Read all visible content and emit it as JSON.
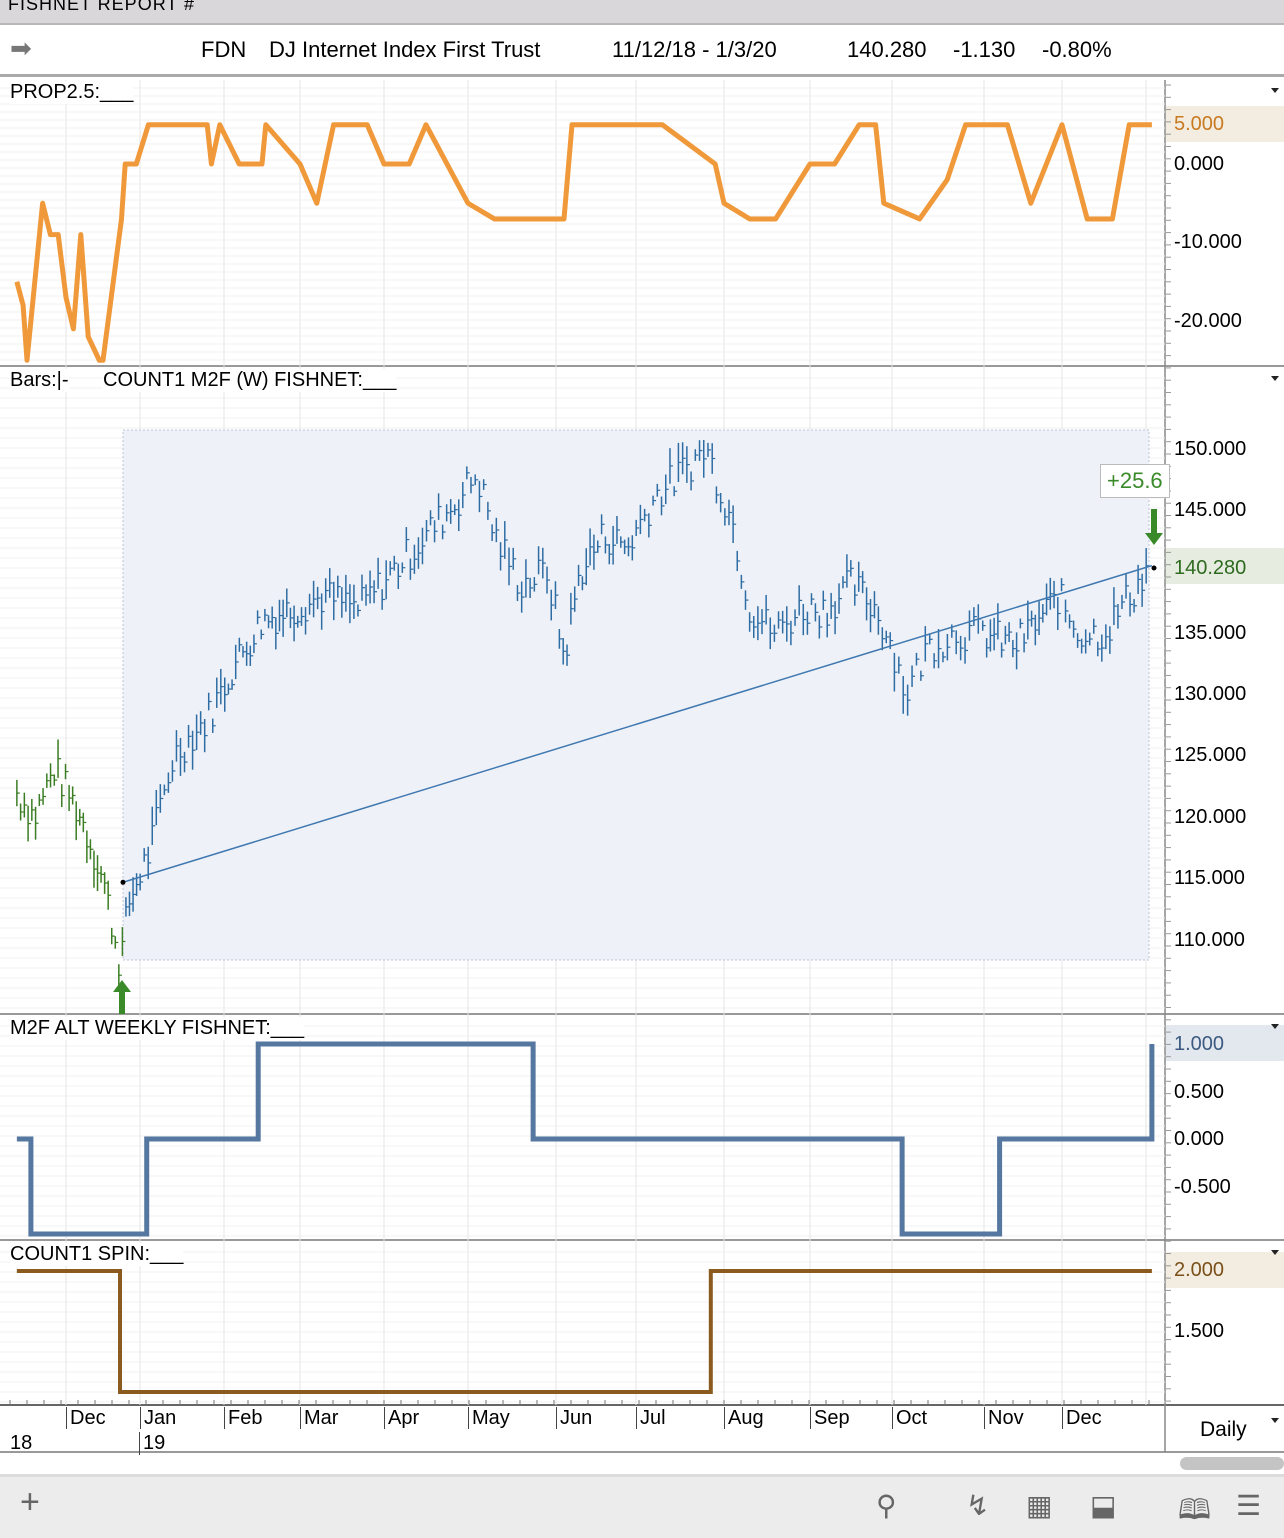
{
  "window": {
    "title": "FISHNET  REPORT #"
  },
  "header": {
    "symbol": "FDN",
    "name": "DJ Internet Index First Trust",
    "date_range": "11/12/18 - 1/3/20",
    "last": "140.280",
    "change": "-1.130",
    "change_pct": "-0.80%"
  },
  "panels": {
    "prop": {
      "label": "PROP2.5:___",
      "axis": [
        "5.000",
        "0.000",
        "-10.000",
        "-20.000"
      ]
    },
    "price": {
      "label_bars": "Bars:|-",
      "label": "COUNT1 M2F (W) FISHNET:___",
      "axis": [
        "150.000",
        "145.000",
        "140.280",
        "135.000",
        "130.000",
        "125.000",
        "120.000",
        "115.000",
        "110.000"
      ],
      "gain_label": "+25.6"
    },
    "m2f": {
      "label": "M2F ALT WEEKLY FISHNET:___",
      "axis": [
        "1.000",
        "0.500",
        "0.000",
        "-0.500"
      ]
    },
    "spin": {
      "label": "COUNT1 SPIN:___",
      "axis": [
        "2.000",
        "1.500"
      ]
    }
  },
  "xaxis": {
    "months": [
      "Dec",
      "Jan",
      "Feb",
      "Mar",
      "Apr",
      "May",
      "Jun",
      "Jul",
      "Aug",
      "Sep",
      "Oct",
      "Nov",
      "Dec"
    ],
    "years": [
      "18",
      "19"
    ],
    "period": "Daily"
  },
  "colors": {
    "prop": "#f0993a",
    "price_up": "#2e6da4",
    "price_pre": "#3a7d23",
    "m2f": "#5577a0",
    "spin": "#8a5a1e",
    "gain": "#3a8a2a"
  },
  "chart_data": [
    {
      "type": "line",
      "title": "PROP2.5",
      "x_unit": "months since Nov 1 2018",
      "ylim": [
        -25,
        7
      ],
      "x": [
        0.37,
        0.45,
        0.5,
        0.6,
        0.7,
        0.8,
        0.9,
        1.0,
        1.1,
        1.2,
        1.3,
        1.45,
        1.5,
        1.75,
        1.8,
        1.95,
        2.1,
        2.15,
        2.8,
        2.85,
        2.95,
        3.2,
        3.5,
        3.55,
        4.0,
        4.2,
        4.3,
        4.4,
        4.8,
        5.0,
        5.3,
        5.5,
        6.0,
        6.3,
        6.6,
        7.1,
        7.2,
        7.4,
        7.6,
        8.0,
        8.3,
        8.9,
        9.0,
        9.3,
        9.6,
        10.0,
        10.3,
        10.6,
        10.8,
        10.9,
        11.3,
        11.6,
        11.8,
        12.0,
        12.3,
        12.6,
        12.8,
        13.0,
        13.3,
        13.6,
        13.8,
        14.0,
        14.07
      ],
      "y": [
        -15,
        -18,
        -25,
        -15,
        -5,
        -9,
        -9,
        -17,
        -21,
        -9,
        -22,
        -25,
        -25,
        -7,
        0,
        0,
        5,
        5,
        5,
        0,
        5,
        0,
        0,
        5,
        0,
        -5,
        0,
        5,
        5,
        0,
        0,
        5,
        -5,
        -7,
        -7,
        -7,
        5,
        5,
        5,
        5,
        5,
        0,
        -5,
        -7,
        -7,
        0,
        0,
        5,
        5,
        -5,
        -7,
        -2,
        5,
        5,
        5,
        -5,
        0,
        5,
        -7,
        -7,
        5,
        5,
        5
      ]
    },
    {
      "type": "bar",
      "title": "FDN price",
      "x_unit": "months since Nov 1 2018",
      "ylim": [
        105,
        152
      ],
      "x": [
        0.37,
        0.6,
        0.85,
        1.2,
        1.5,
        1.73,
        1.85,
        2.1,
        2.4,
        2.8,
        3.1,
        3.5,
        3.9,
        4.3,
        4.7,
        5.1,
        5.5,
        5.9,
        6.1,
        6.3,
        6.6,
        6.9,
        7.1,
        7.3,
        7.6,
        7.9,
        8.2,
        8.5,
        8.8,
        9.1,
        9.3,
        9.6,
        9.9,
        10.2,
        10.5,
        10.8,
        11.0,
        11.15,
        11.4,
        11.7,
        12.0,
        12.4,
        12.7,
        12.95,
        13.2,
        13.5,
        13.8,
        14.05
      ],
      "y": [
        122,
        120,
        124,
        120,
        115,
        108,
        113,
        117,
        125,
        128,
        132,
        136,
        137,
        138,
        137,
        140,
        143,
        146,
        148,
        143,
        139,
        140,
        133,
        140,
        143,
        142,
        146,
        148,
        150,
        144,
        137,
        135,
        137,
        137,
        139,
        137,
        134,
        130,
        134,
        135,
        135,
        134,
        136,
        138,
        135,
        135,
        138,
        140.28
      ],
      "trendline": {
        "x": [
          1.77,
          14.07
        ],
        "y": [
          114.7,
          140.5
        ]
      }
    },
    {
      "type": "line",
      "title": "M2F ALT WEEKLY FISHNET",
      "step": true,
      "ylim": [
        -1.2,
        1.2
      ],
      "x": [
        0.37,
        0.55,
        2.08,
        3.45,
        6.74,
        11.11,
        12.2,
        14.07
      ],
      "y": [
        0,
        -1,
        0,
        1,
        0,
        -1,
        0,
        1
      ]
    },
    {
      "type": "line",
      "title": "COUNT1 SPIN",
      "step": true,
      "ylim": [
        0.9,
        2.2
      ],
      "x": [
        0.37,
        1.73,
        8.85,
        14.07
      ],
      "y": [
        2,
        1,
        2,
        2
      ]
    }
  ]
}
